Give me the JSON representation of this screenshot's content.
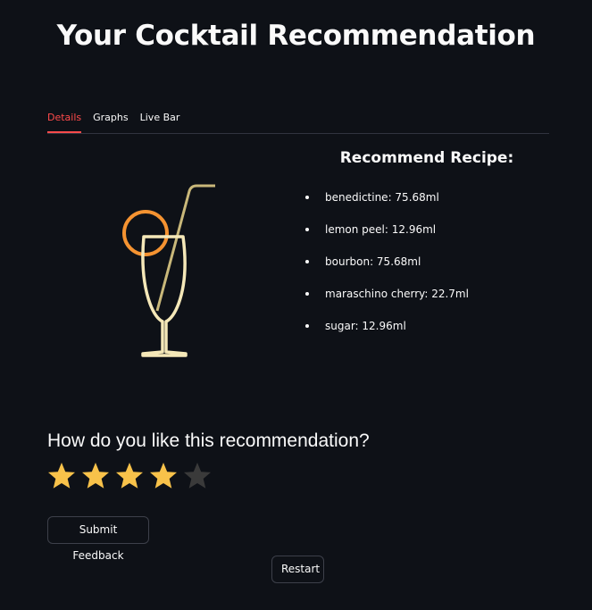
{
  "page": {
    "title": "Your Cocktail Recommendation"
  },
  "tabs": [
    {
      "label": "Details",
      "active": true
    },
    {
      "label": "Graphs",
      "active": false
    },
    {
      "label": "Live Bar",
      "active": false
    }
  ],
  "recipe": {
    "heading": "Recommend Recipe:",
    "items": [
      "benedictine: 75.68ml",
      "lemon peel: 12.96ml",
      "bourbon: 75.68ml",
      "maraschino cherry: 22.7ml",
      "sugar: 12.96ml"
    ]
  },
  "feedback": {
    "question": "How do you like this recommendation?",
    "rating": 4,
    "max_rating": 5,
    "submit_label": "Submit Feedback"
  },
  "restart_label": "Restart",
  "colors": {
    "background": "#0e1117",
    "accent": "#ff4b4b",
    "star_filled": "#f8c24a",
    "star_empty": "#3a3a3a",
    "glass": "#f5e8b8",
    "orange_slice": "#f59331",
    "straw": "#c9b87a"
  },
  "icons": {
    "illustration": "cocktail-glass-icon",
    "rating": "star-icon"
  }
}
